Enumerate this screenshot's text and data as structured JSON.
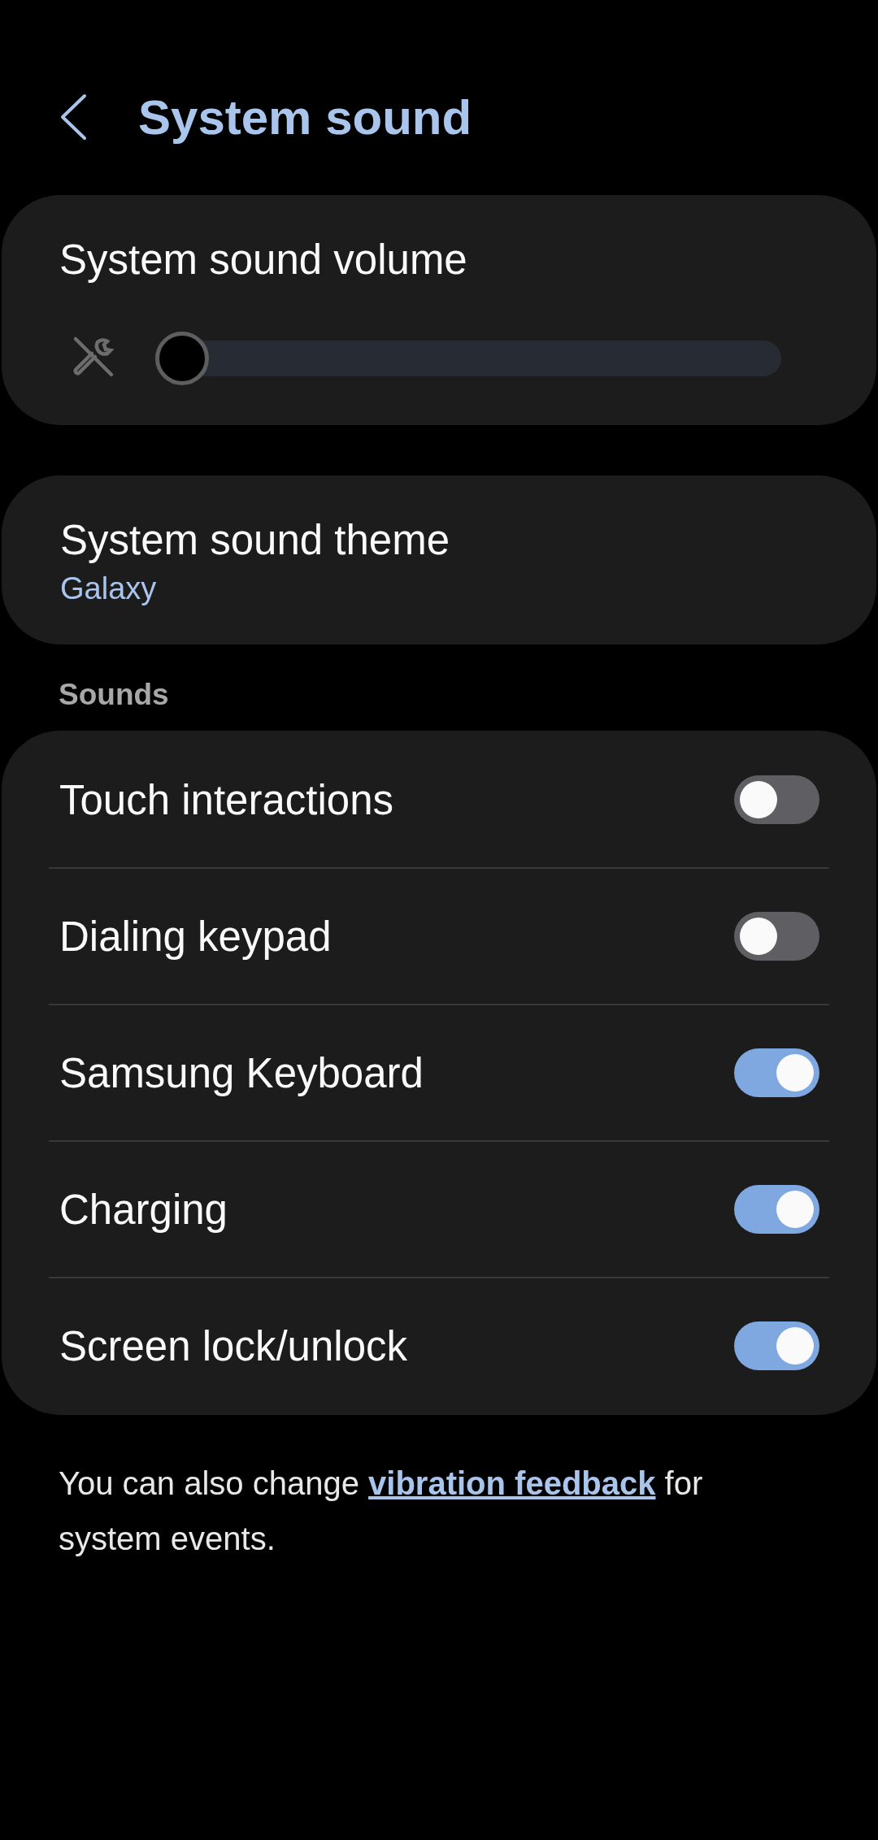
{
  "header": {
    "title": "System sound"
  },
  "volume": {
    "label": "System sound volume",
    "level": 0
  },
  "theme": {
    "label": "System sound theme",
    "value": "Galaxy"
  },
  "sounds": {
    "heading": "Sounds",
    "items": [
      {
        "label": "Touch interactions",
        "on": false
      },
      {
        "label": "Dialing keypad",
        "on": false
      },
      {
        "label": "Samsung Keyboard",
        "on": true
      },
      {
        "label": "Charging",
        "on": true
      },
      {
        "label": "Screen lock/unlock",
        "on": true
      }
    ]
  },
  "footer": {
    "before": "You can also change ",
    "link": "vibration feedback",
    "after": " for system events."
  }
}
